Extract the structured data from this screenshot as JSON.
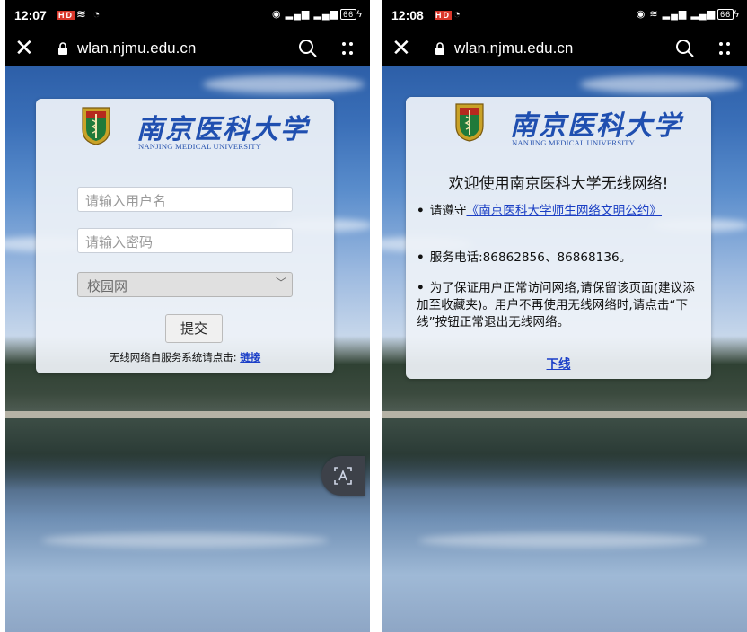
{
  "left_screen": {
    "status": {
      "time": "12:07",
      "hd_badge": "HD",
      "battery": "66"
    },
    "browser": {
      "url": "wlan.njmu.edu.cn"
    },
    "logo": {
      "cn": "南京医科大学",
      "en": "NANJING MEDICAL UNIVERSITY"
    },
    "login": {
      "username_placeholder": "请输入用户名",
      "password_placeholder": "请输入密码",
      "network_selected": "校园网",
      "submit_label": "提交",
      "selfservice_text": "无线网络自服务系统请点击:",
      "selfservice_link": "链接"
    }
  },
  "right_screen": {
    "status": {
      "time": "12:08",
      "hd_badge": "HD",
      "battery": "66"
    },
    "browser": {
      "url": "wlan.njmu.edu.cn"
    },
    "logo": {
      "cn": "南京医科大学",
      "en": "NANJING MEDICAL UNIVERSITY"
    },
    "welcome": "欢迎使用南京医科大学无线网络!",
    "notice1_prefix": "请遵守",
    "notice1_link": "《南京医科大学师生网络文明公约》",
    "phone_text": "服务电话:86862856、86868136。",
    "notice2_text": "为了保证用户正常访问网络,请保留该页面(建议添加至收藏夹)。用户不再使用无线网络时,请点击“下线”按钮正常退出无线网络。",
    "logout_label": "下线"
  }
}
